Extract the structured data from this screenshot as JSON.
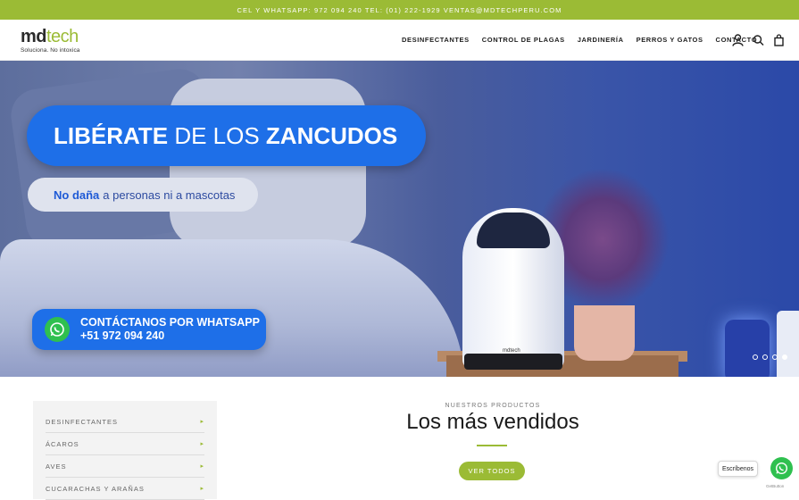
{
  "topbar": {
    "text": "CEL Y WHATSAPP: 972 094 240 TEL: (01) 222-1929 VENTAS@MDTECHPERU.COM"
  },
  "brand": {
    "logo_md": "md",
    "logo_tech": "tech",
    "tagline": "Soluciona. No intoxica"
  },
  "nav": {
    "items": [
      {
        "label": "DESINFECTANTES"
      },
      {
        "label": "CONTROL DE PLAGAS"
      },
      {
        "label": "JARDINERÍA"
      },
      {
        "label": "PERROS Y GATOS"
      },
      {
        "label": "CONTACTO"
      }
    ]
  },
  "header_icons": [
    "account-icon",
    "search-icon",
    "cart-icon"
  ],
  "hero": {
    "headline_bold1": "LIBÉRATE",
    "headline_light": "DE LOS",
    "headline_bold2": "ZANCUDOS",
    "sub_bold": "No daña",
    "sub_rest": "a personas ni a mascotas",
    "cta_line1": "CONTÁCTANOS POR WHATSAPP",
    "cta_line2": "+51 972 094 240",
    "device_logo": "mdtech",
    "slides": 4,
    "active_slide": 4
  },
  "sidebar": {
    "items": [
      {
        "label": "DESINFECTANTES"
      },
      {
        "label": "ÁCAROS"
      },
      {
        "label": "AVES"
      },
      {
        "label": "CUCARACHAS Y ARAÑAS"
      }
    ],
    "arrow": "▸"
  },
  "products": {
    "eyebrow": "NUESTROS PRODUCTOS",
    "title": "Los más vendidos",
    "view_all": "VER TODOS"
  },
  "chat": {
    "label": "Escríbenos",
    "powered": "GetButton"
  },
  "colors": {
    "accent": "#9bbb35",
    "hero_blue": "#1e6fe8",
    "whatsapp": "#2fc04f"
  }
}
